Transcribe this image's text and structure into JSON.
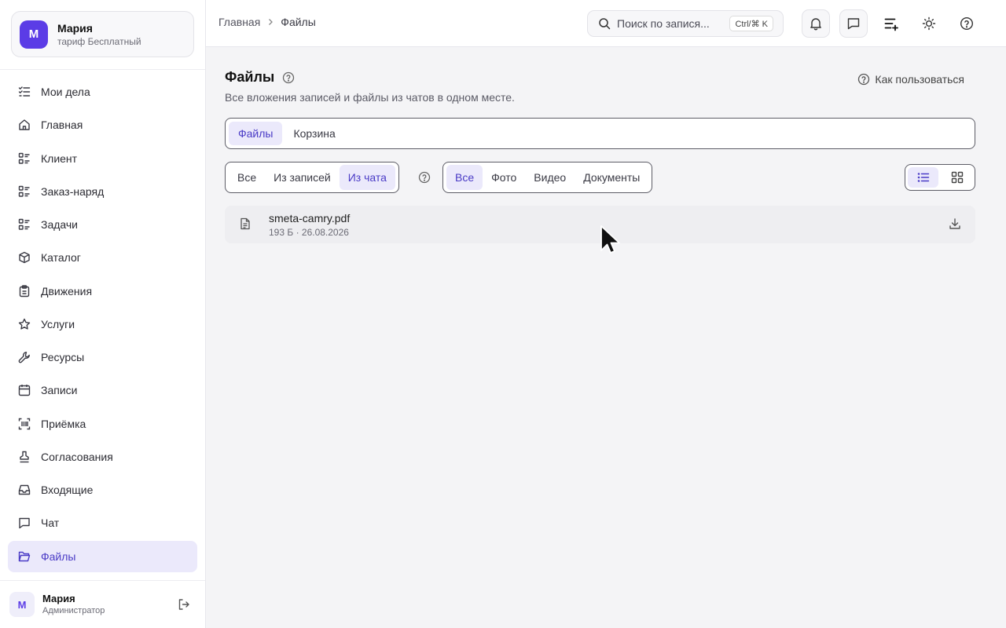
{
  "profile": {
    "initial": "М",
    "name": "Мария",
    "plan": "тариф Бесплатный"
  },
  "sidebar": {
    "items": [
      {
        "label": "Мои дела",
        "icon": "checklist-icon"
      },
      {
        "label": "Главная",
        "icon": "home-icon"
      },
      {
        "label": "Клиент",
        "icon": "list-icon"
      },
      {
        "label": "Заказ-наряд",
        "icon": "list-icon"
      },
      {
        "label": "Задачи",
        "icon": "list-icon"
      },
      {
        "label": "Каталог",
        "icon": "box-icon"
      },
      {
        "label": "Движения",
        "icon": "clipboard-icon"
      },
      {
        "label": "Услуги",
        "icon": "star-icon"
      },
      {
        "label": "Ресурсы",
        "icon": "wrench-icon"
      },
      {
        "label": "Записи",
        "icon": "calendar-icon"
      },
      {
        "label": "Приёмка",
        "icon": "scan-icon"
      },
      {
        "label": "Согласования",
        "icon": "stamp-icon"
      },
      {
        "label": "Входящие",
        "icon": "inbox-icon"
      },
      {
        "label": "Чат",
        "icon": "chat-icon"
      },
      {
        "label": "Файлы",
        "icon": "folder-icon",
        "active": true
      }
    ]
  },
  "user": {
    "initial": "М",
    "name": "Мария",
    "role": "Администратор"
  },
  "header": {
    "breadcrumb": [
      "Главная",
      "Файлы"
    ],
    "search_placeholder": "Поиск по записям...",
    "search_display": "Поиск по запися...",
    "shortcut": "Ctrl/⌘ K"
  },
  "page": {
    "title": "Файлы",
    "subtitle": "Все вложения записей и файлы из чатов в одном месте.",
    "howto": "Как пользоваться",
    "tabs": [
      "Файлы",
      "Корзина"
    ],
    "active_tab": "Файлы",
    "source_filter": [
      "Все",
      "Из записей",
      "Из чата"
    ],
    "active_source": "Из чата",
    "type_filter": [
      "Все",
      "Фото",
      "Видео",
      "Документы"
    ],
    "active_type": "Все",
    "view_mode": "list"
  },
  "files": [
    {
      "name": "smeta-camry.pdf",
      "meta": "193 Б · 26.08.2026"
    }
  ],
  "colors": {
    "accent": "#5b3ce6",
    "accent_bg": "#ebe9fb",
    "accent_text": "#4a3bc6"
  }
}
